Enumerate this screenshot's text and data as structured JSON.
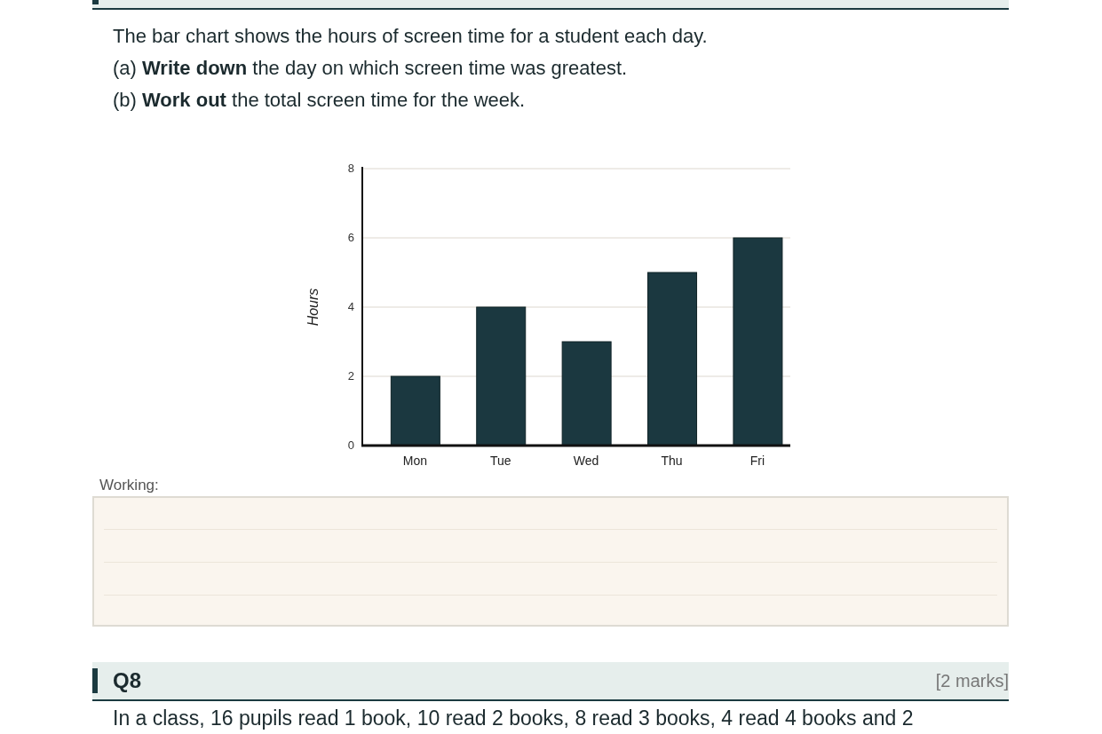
{
  "question_7": {
    "lines": [
      "The bar chart shows the hours of screen time for a student each day.",
      "(a) **Write down** the day on which screen time was greatest.",
      "(b) **Work out** the total screen time for the week."
    ],
    "chart_data": {
      "type": "bar",
      "ylabel": "Hours",
      "categories": [
        "Mon",
        "Tue",
        "Wed",
        "Thu",
        "Fri"
      ],
      "values": [
        2,
        4,
        3,
        5,
        6
      ],
      "ylim": [
        0,
        8
      ],
      "yticks": [
        0,
        2,
        4,
        6,
        8
      ],
      "grid": true
    },
    "working": {
      "label": "Working:"
    }
  },
  "question_8": {
    "title": "Q8",
    "marks": "[2 marks]",
    "text": "In a class, 16 pupils read 1 book, 10 read 2 books, 8 read 3 books, 4 read 4 books and 2"
  }
}
